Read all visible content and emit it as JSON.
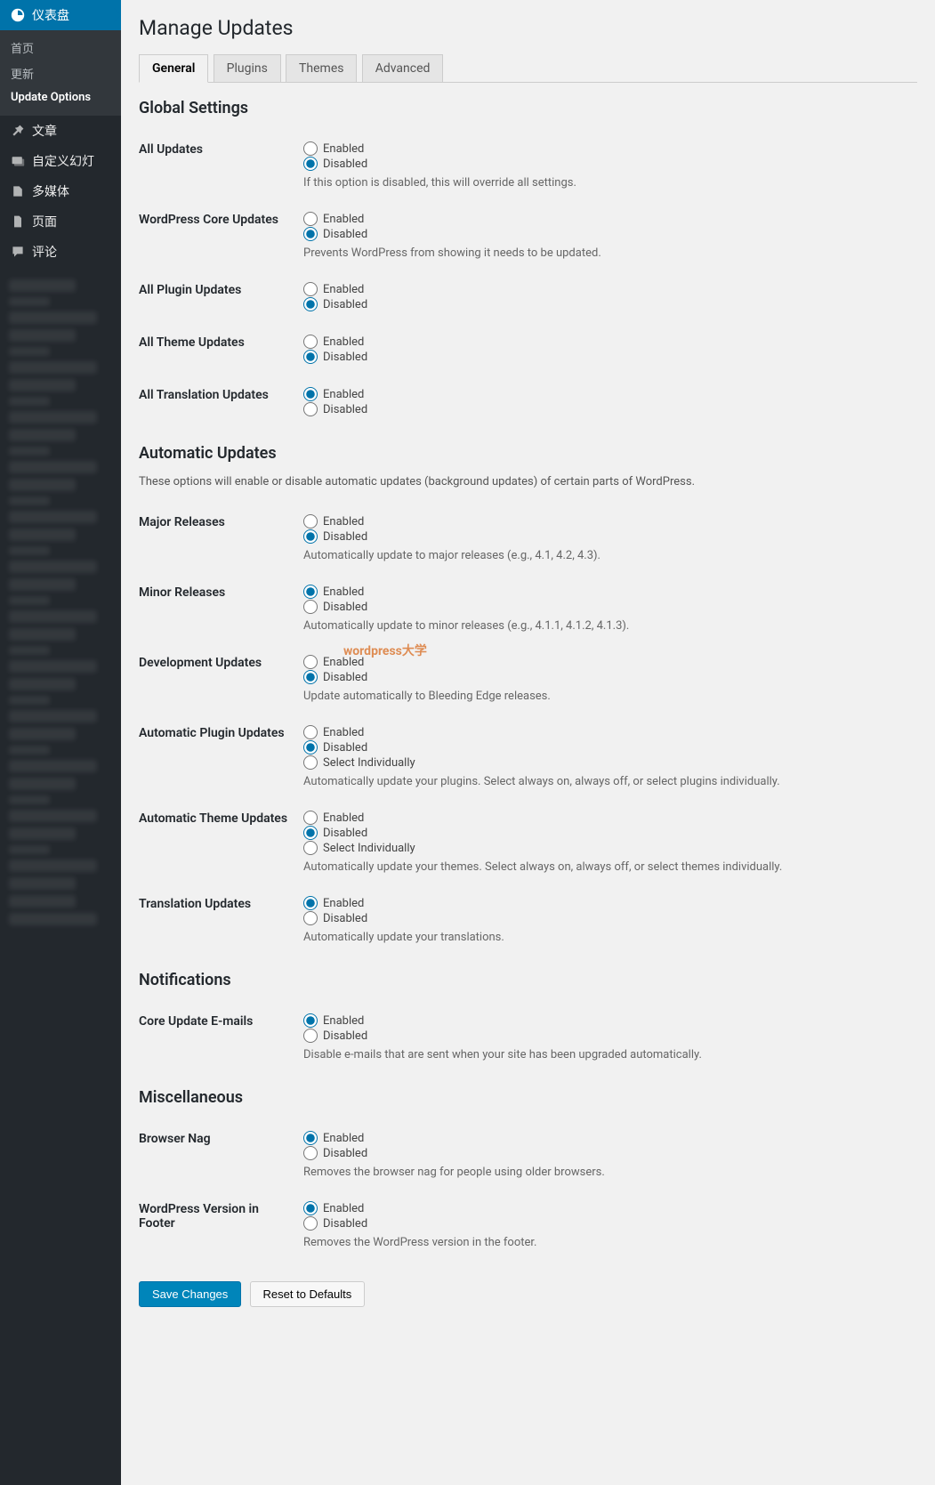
{
  "sidebar": {
    "dashboard": "仪表盘",
    "dashboard_subs": [
      "首页",
      "更新",
      "Update Options"
    ],
    "posts": "文章",
    "slides": "自定义幻灯",
    "media": "多媒体",
    "pages": "页面",
    "comments": "评论"
  },
  "page": {
    "title": "Manage Updates",
    "tabs": [
      "General",
      "Plugins",
      "Themes",
      "Advanced"
    ]
  },
  "sections": {
    "global": {
      "heading": "Global Settings",
      "all_updates": {
        "label": "All Updates",
        "enabled": "Enabled",
        "disabled": "Disabled",
        "desc": "If this option is disabled, this will override all settings."
      },
      "wp_core": {
        "label": "WordPress Core Updates",
        "enabled": "Enabled",
        "disabled": "Disabled",
        "desc": "Prevents WordPress from showing it needs to be updated."
      },
      "all_plugin": {
        "label": "All Plugin Updates",
        "enabled": "Enabled",
        "disabled": "Disabled"
      },
      "all_theme": {
        "label": "All Theme Updates",
        "enabled": "Enabled",
        "disabled": "Disabled"
      },
      "all_translation": {
        "label": "All Translation Updates",
        "enabled": "Enabled",
        "disabled": "Disabled"
      }
    },
    "auto": {
      "heading": "Automatic Updates",
      "intro": "These options will enable or disable automatic updates (background updates) of certain parts of WordPress.",
      "major": {
        "label": "Major Releases",
        "enabled": "Enabled",
        "disabled": "Disabled",
        "desc": "Automatically update to major releases (e.g., 4.1, 4.2, 4.3)."
      },
      "minor": {
        "label": "Minor Releases",
        "enabled": "Enabled",
        "disabled": "Disabled",
        "desc": "Automatically update to minor releases (e.g., 4.1.1, 4.1.2, 4.1.3)."
      },
      "dev": {
        "label": "Development Updates",
        "enabled": "Enabled",
        "disabled": "Disabled",
        "desc": "Update automatically to Bleeding Edge releases."
      },
      "plugin": {
        "label": "Automatic Plugin Updates",
        "enabled": "Enabled",
        "disabled": "Disabled",
        "select": "Select Individually",
        "desc": "Automatically update your plugins. Select always on, always off, or select plugins individually."
      },
      "theme": {
        "label": "Automatic Theme Updates",
        "enabled": "Enabled",
        "disabled": "Disabled",
        "select": "Select Individually",
        "desc": "Automatically update your themes. Select always on, always off, or select themes individually."
      },
      "translation": {
        "label": "Translation Updates",
        "enabled": "Enabled",
        "disabled": "Disabled",
        "desc": "Automatically update your translations."
      }
    },
    "notif": {
      "heading": "Notifications",
      "core_email": {
        "label": "Core Update E-mails",
        "enabled": "Enabled",
        "disabled": "Disabled",
        "desc": "Disable e-mails that are sent when your site has been upgraded automatically."
      }
    },
    "misc": {
      "heading": "Miscellaneous",
      "browser_nag": {
        "label": "Browser Nag",
        "enabled": "Enabled",
        "disabled": "Disabled",
        "desc": "Removes the browser nag for people using older browsers."
      },
      "version_footer": {
        "label": "WordPress Version in Footer",
        "enabled": "Enabled",
        "disabled": "Disabled",
        "desc": "Removes the WordPress version in the footer."
      }
    }
  },
  "actions": {
    "save": "Save Changes",
    "reset": "Reset to Defaults"
  },
  "watermark": "wordpress大学"
}
